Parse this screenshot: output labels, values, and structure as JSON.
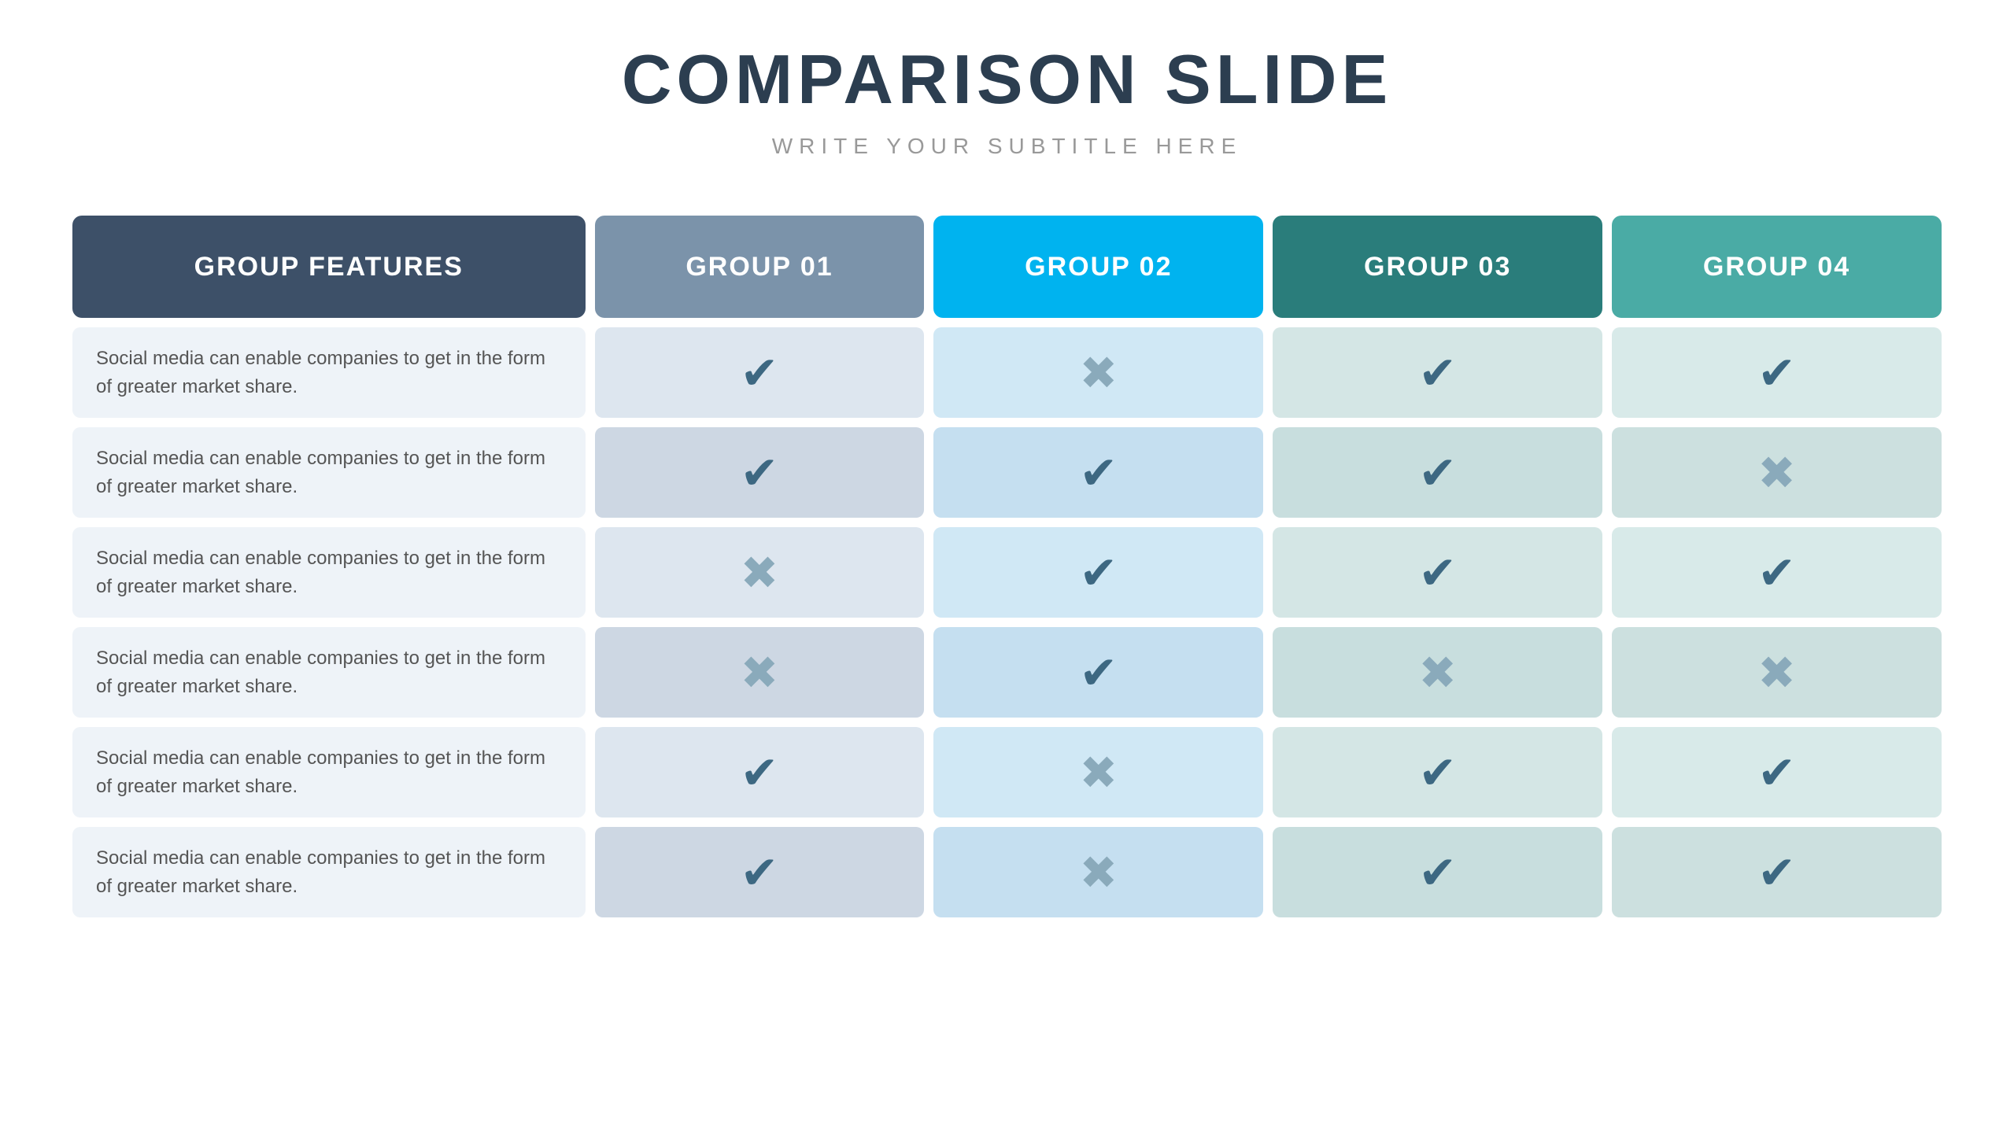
{
  "header": {
    "title": "COMPARISON SLIDE",
    "subtitle": "WRITE YOUR SUBTITLE HERE"
  },
  "columns": {
    "features": "GROUP FEATURES",
    "g1": "GROUP 01",
    "g2": "GROUP 02",
    "g3": "GROUP 03",
    "g4": "GROUP 04"
  },
  "feature_text": "Social media can enable companies to get in the form of greater market share.",
  "rows": [
    {
      "g1": "check",
      "g2": "cross",
      "g3": "check",
      "g4": "check"
    },
    {
      "g1": "check",
      "g2": "check",
      "g3": "check",
      "g4": "cross"
    },
    {
      "g1": "cross",
      "g2": "check",
      "g3": "check",
      "g4": "check"
    },
    {
      "g1": "cross",
      "g2": "check",
      "g3": "cross",
      "g4": "cross"
    },
    {
      "g1": "check",
      "g2": "cross",
      "g3": "check",
      "g4": "check"
    },
    {
      "g1": "check",
      "g2": "cross",
      "g3": "check",
      "g4": "check"
    }
  ]
}
